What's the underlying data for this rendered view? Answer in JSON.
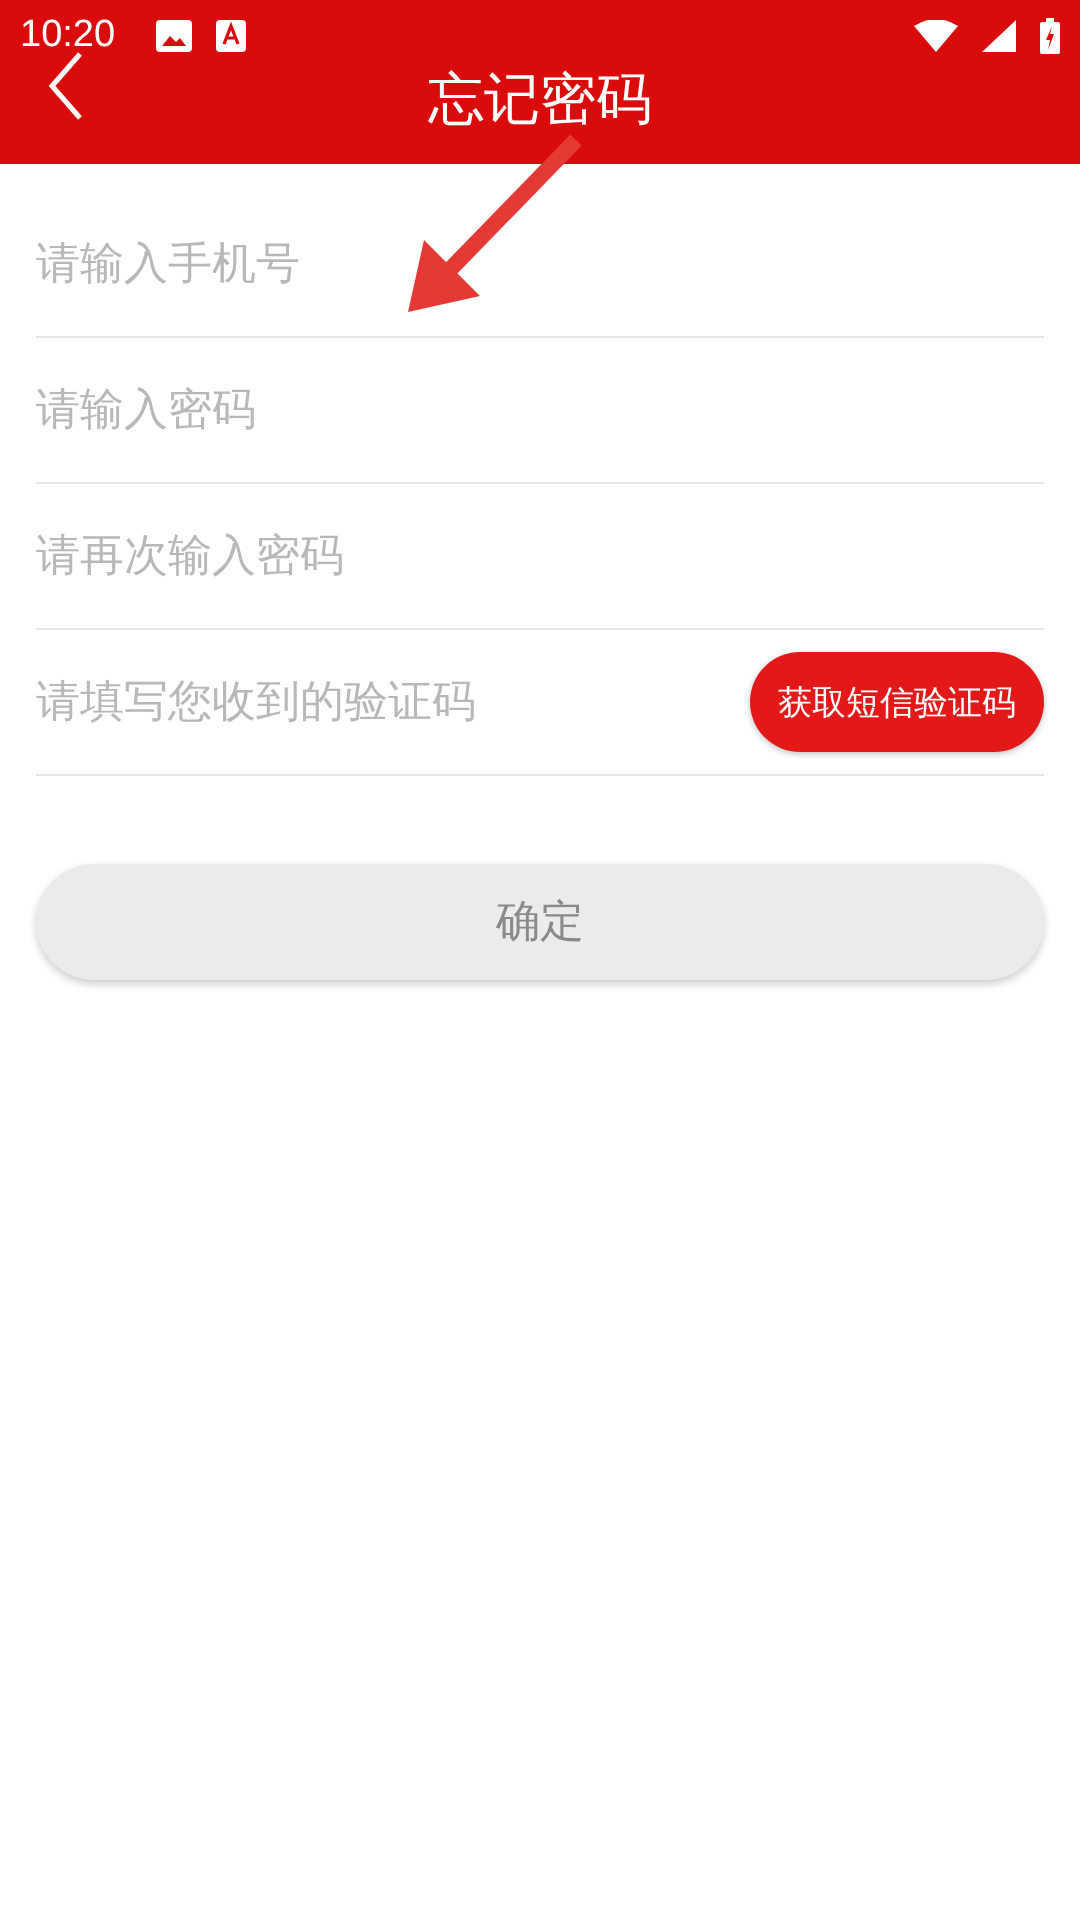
{
  "status_bar": {
    "time": "10:20"
  },
  "header": {
    "title": "忘记密码"
  },
  "fields": [
    {
      "placeholder": "请输入手机号"
    },
    {
      "placeholder": "请输入密码"
    },
    {
      "placeholder": "请再次输入密码"
    },
    {
      "placeholder": "请填写您收到的验证码",
      "action_button": "获取短信验证码"
    }
  ],
  "submit": {
    "label": "确定",
    "disabled": true
  }
}
